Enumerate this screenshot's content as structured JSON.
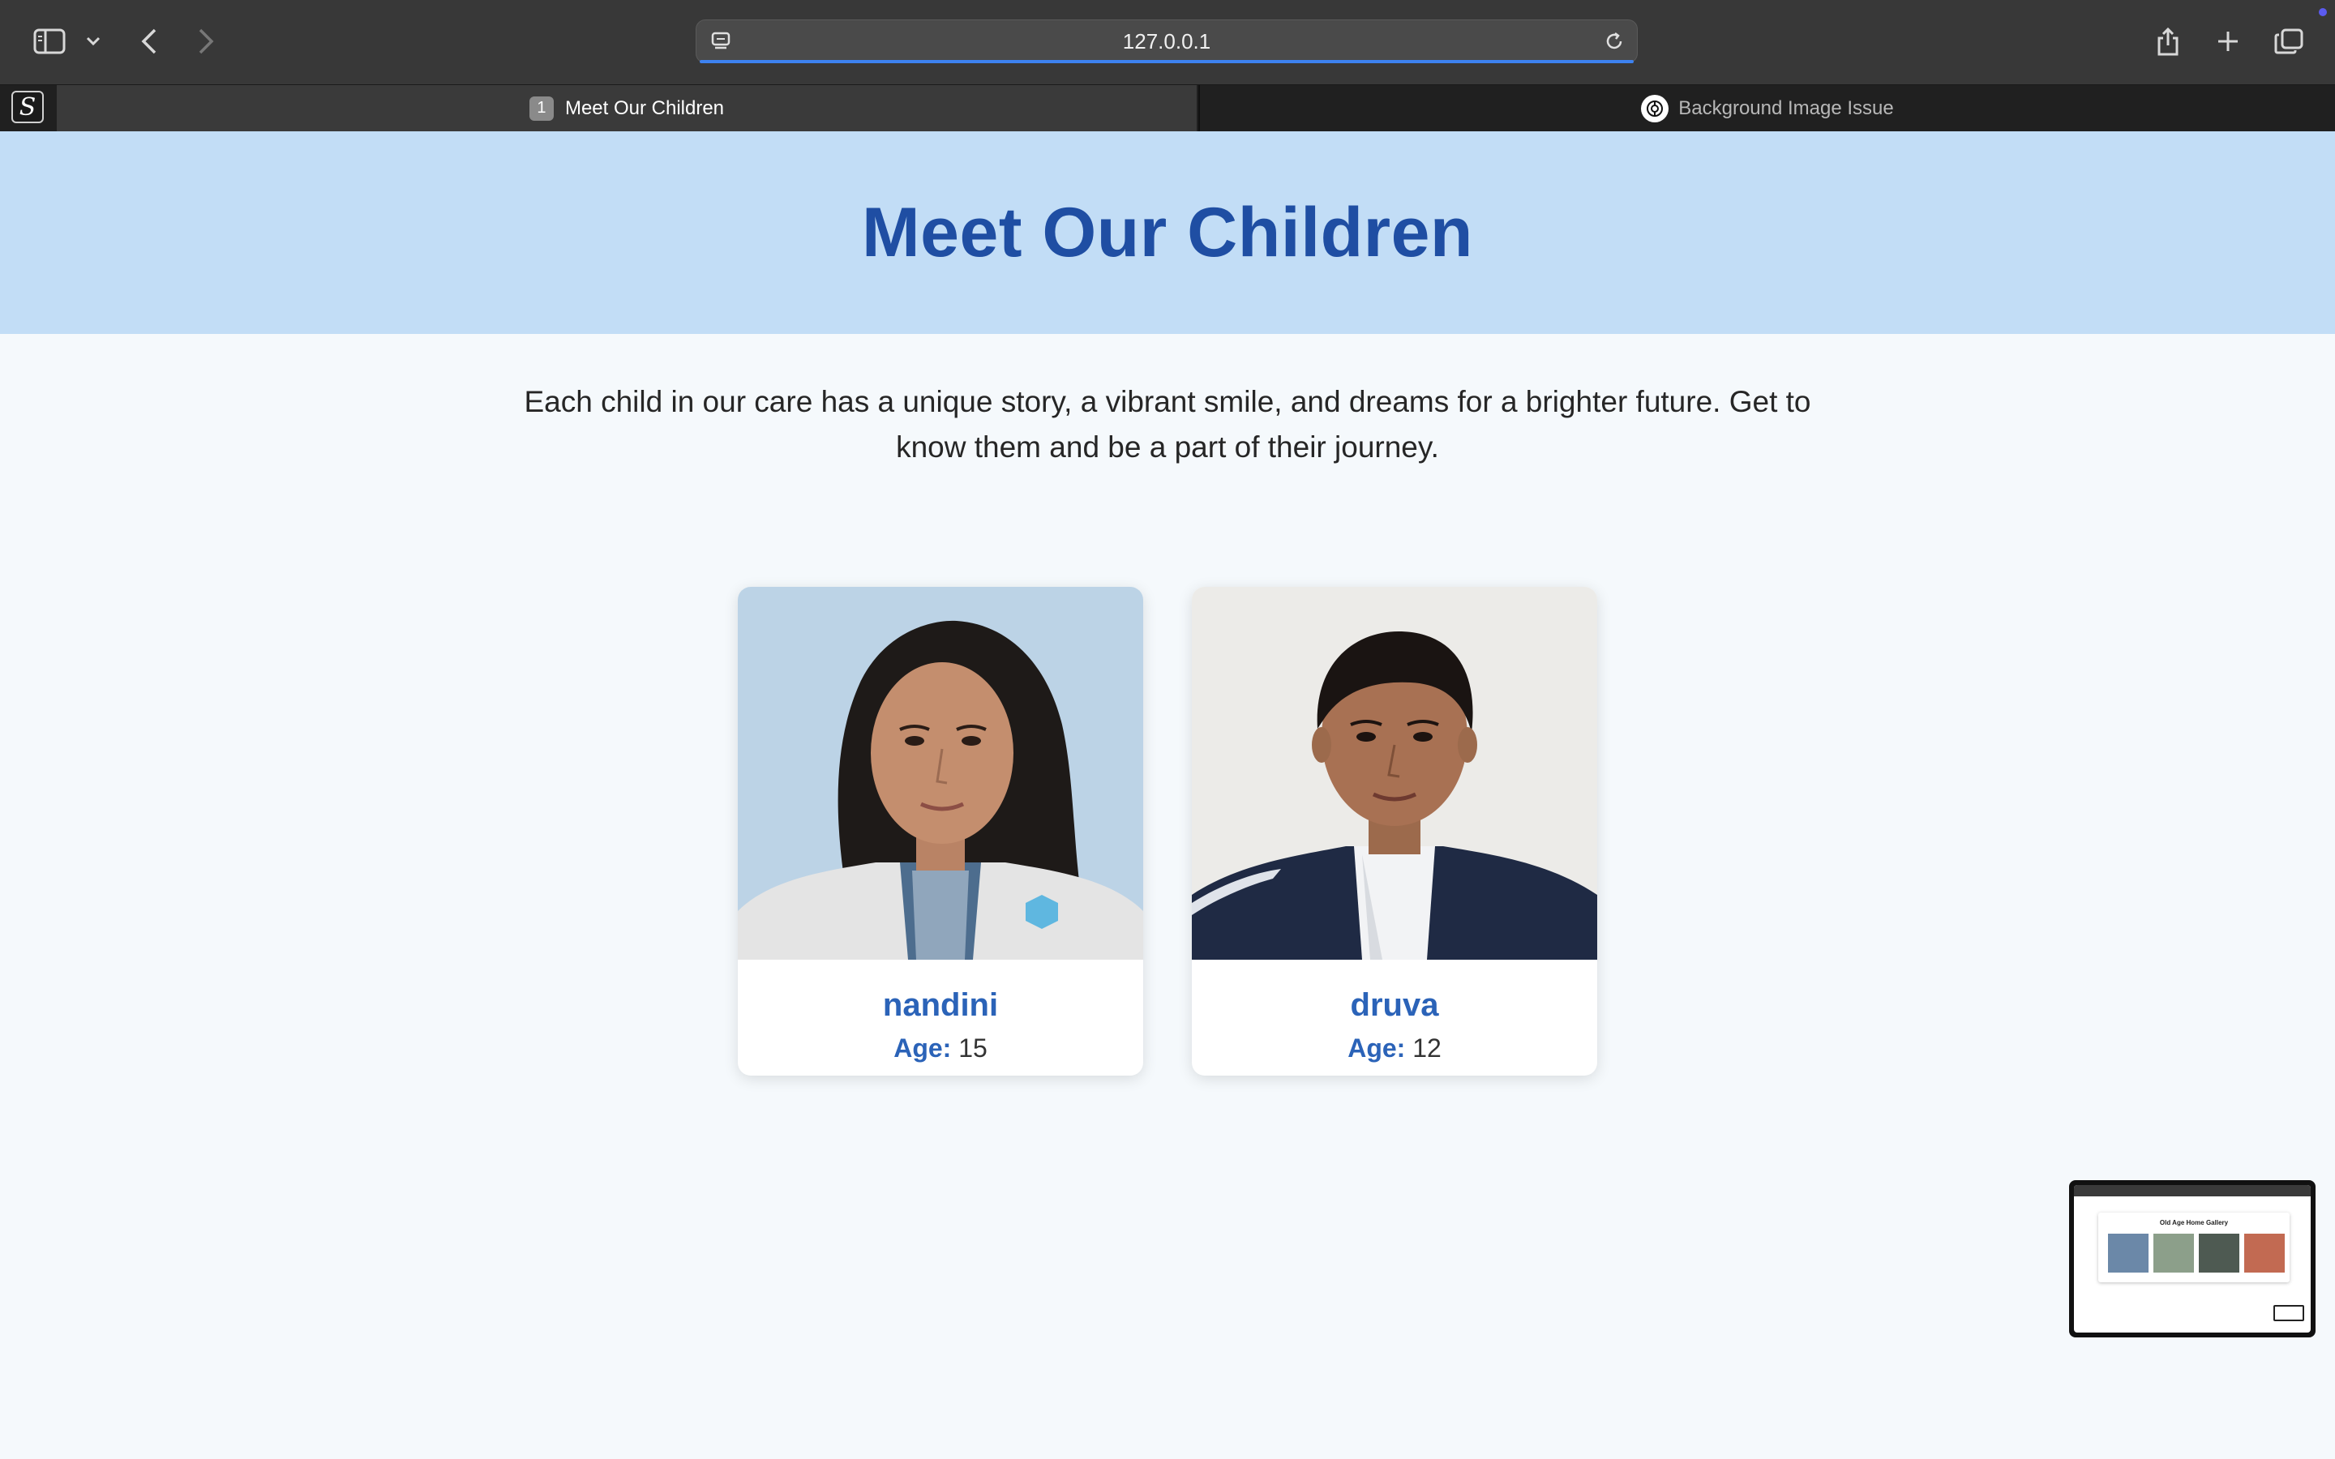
{
  "browser": {
    "url": "127.0.0.1",
    "tabs": [
      {
        "badge": "1",
        "label": "Meet Our Children",
        "active": true
      },
      {
        "label": "Background Image Issue",
        "active": false
      }
    ],
    "site_icon_letter": "S",
    "accent_color": "#3d82f0"
  },
  "page": {
    "title": "Meet Our Children",
    "intro": "Each child in our care has a unique story, a vibrant smile, and dreams for a brighter future. Get to know them and be a part of their journey.",
    "age_label": "Age:",
    "children": [
      {
        "name": "nandini",
        "age": "15",
        "photo": "girl-portrait"
      },
      {
        "name": "druva",
        "age": "12",
        "photo": "boy-portrait"
      }
    ],
    "colors": {
      "header_bg": "#c2ddf6",
      "title": "#1f4ea3",
      "accent": "#2b63b8"
    }
  },
  "thumbnail": {
    "title": "Old Age Home Gallery"
  }
}
